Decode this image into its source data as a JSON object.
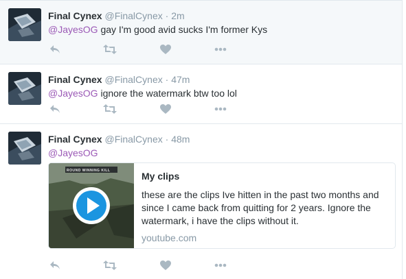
{
  "tweets": [
    {
      "name": "Final Cynex",
      "handle": "@FinalCynex",
      "separator": "·",
      "time": "2m",
      "mention": "@JayesOG",
      "text": " gay I'm good avid sucks I'm former Kys"
    },
    {
      "name": "Final Cynex",
      "handle": "@FinalCynex",
      "separator": "·",
      "time": "47m",
      "mention": "@JayesOG",
      "text": " ignore the watermark btw too lol"
    },
    {
      "name": "Final Cynex",
      "handle": "@FinalCynex",
      "separator": "·",
      "time": "48m",
      "mention": "@JayesOG",
      "text": "",
      "card": {
        "title": "My clips",
        "description": "these are the clips Ive hitten in the past two months and since I came back from quitting for 2 years. Ignore the watermark, i have the clips without it.",
        "domain": "youtube.com",
        "thumbnail_caption": "ROUND WINNING KILL",
        "play_icon": "play-icon"
      }
    }
  ],
  "action_icons": [
    "reply-icon",
    "retweet-icon",
    "like-icon",
    "more-icon"
  ],
  "colors": {
    "mention": "#9b59b6",
    "meta": "#8899a6",
    "icon": "#aab8c2",
    "highlight_bg": "#f5f8fa",
    "play_button": "#1b95e0"
  }
}
